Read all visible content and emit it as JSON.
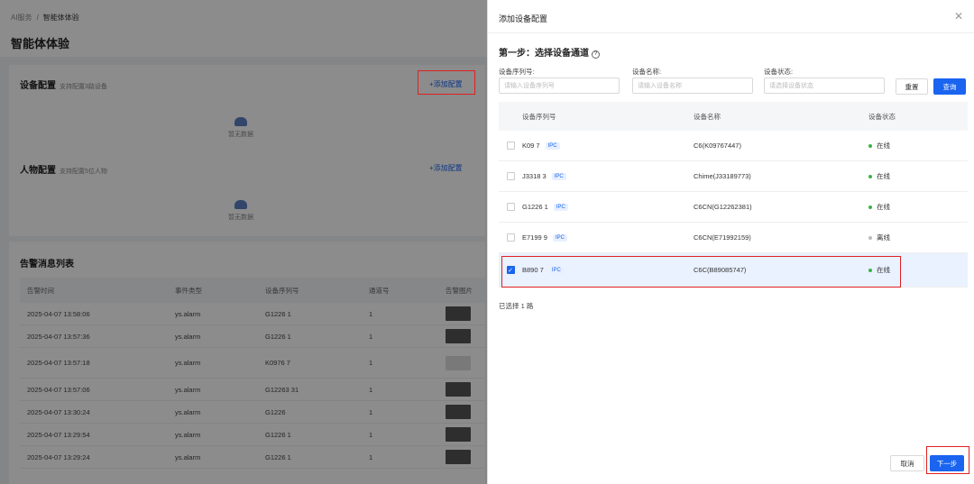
{
  "breadcrumb": {
    "parent": "AI服务",
    "separator": "/",
    "current": "智能体体验"
  },
  "page_title": "智能体体验",
  "device_config": {
    "title": "设备配置",
    "subtitle": "支持配置3路设备",
    "add_label": "+添加配置",
    "empty_text": "暂无数据"
  },
  "person_config": {
    "title": "人物配置",
    "subtitle": "支持配置5位人物",
    "add_label": "+添加配置",
    "empty_text": "暂无数据"
  },
  "alarm": {
    "title": "告警消息列表",
    "columns": [
      "告警时间",
      "事件类型",
      "设备序列号",
      "通道号",
      "告警图片"
    ],
    "rows": [
      {
        "time": "2025-04-07 13:58:06",
        "type": "ys.alarm",
        "serial": "G1226   1",
        "channel": "1",
        "image": "dark"
      },
      {
        "time": "2025-04-07 13:57:36",
        "type": "ys.alarm",
        "serial": "G1226   1",
        "channel": "1",
        "image": "dark"
      },
      {
        "time": "2025-04-07 13:57:18",
        "type": "ys.alarm",
        "serial": "K0976   7",
        "channel": "1",
        "image": "light"
      },
      {
        "time": "2025-04-07 13:57:06",
        "type": "ys.alarm",
        "serial": "G12263  31",
        "channel": "1",
        "image": "dark"
      },
      {
        "time": "2025-04-07 13:30:24",
        "type": "ys.alarm",
        "serial": "G1226",
        "channel": "1",
        "image": "dark"
      },
      {
        "time": "2025-04-07 13:29:54",
        "type": "ys.alarm",
        "serial": "G1226   1",
        "channel": "1",
        "image": "dark"
      },
      {
        "time": "2025-04-07 13:29:24",
        "type": "ys.alarm",
        "serial": "G1226   1",
        "channel": "1",
        "image": "dark"
      }
    ]
  },
  "drawer": {
    "title": "添加设备配置",
    "close_icon": "close-icon",
    "step_title": "第一步：选择设备通道",
    "help_glyph": "?",
    "filters": {
      "serial_label": "设备序列号:",
      "serial_placeholder": "请输入设备序列号",
      "name_label": "设备名称:",
      "name_placeholder": "请输入设备名称",
      "status_label": "设备状态:",
      "status_placeholder": "请选择设备状态"
    },
    "reset_label": "重置",
    "query_label": "查询",
    "table_columns": [
      "设备序列号",
      "设备名称",
      "设备状态"
    ],
    "devices": [
      {
        "serial": "K09     7",
        "tag": "IPC",
        "name": "C6(K09767447)",
        "status": "在线",
        "online": true,
        "checked": false
      },
      {
        "serial": "J3318   3",
        "tag": "IPC",
        "name": "Chime(J33189773)",
        "status": "在线",
        "online": true,
        "checked": false
      },
      {
        "serial": "G1226    1",
        "tag": "IPC",
        "name": "C6CN(G12262381)",
        "status": "在线",
        "online": true,
        "checked": false
      },
      {
        "serial": "E7199   9",
        "tag": "IPC",
        "name": "C6CN(E71992159)",
        "status": "离线",
        "online": false,
        "checked": false
      },
      {
        "serial": "B890     7",
        "tag": "IPC",
        "name": "C6C(B89085747)",
        "status": "在线",
        "online": true,
        "checked": true
      }
    ],
    "selected_count": "已选择 1 路",
    "cancel_label": "取消",
    "next_label": "下一步"
  },
  "colors": {
    "primary": "#1a64f0",
    "online": "#3bb346",
    "offline": "#bbbbbb",
    "highlight": "#e02020"
  }
}
